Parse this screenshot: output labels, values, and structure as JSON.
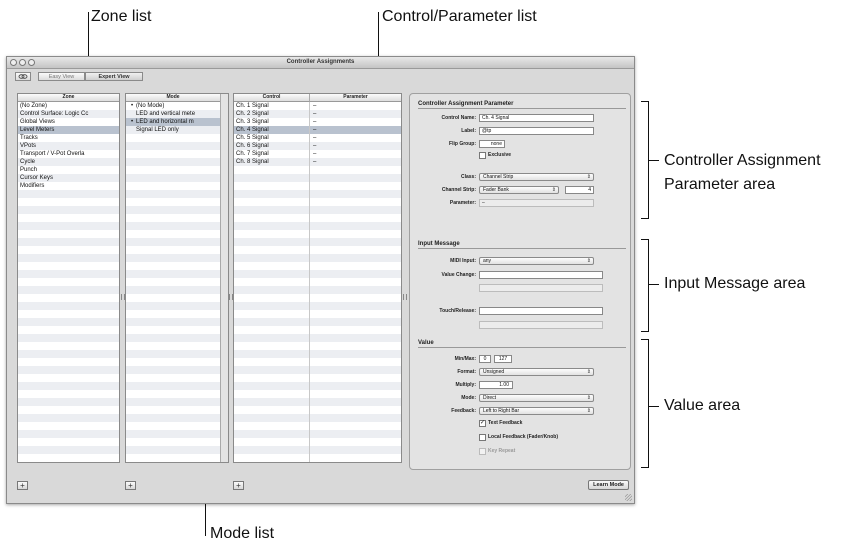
{
  "callouts": {
    "zone_list": "Zone list",
    "control_parameter_list": "Control/Parameter list",
    "ca_param_area_line1": "Controller Assignment",
    "ca_param_area_line2": "Parameter area",
    "input_message_area": "Input Message area",
    "value_area": "Value area",
    "mode_list": "Mode list"
  },
  "window": {
    "title": "Controller Assignments",
    "easy_view": "Easy View",
    "expert_view": "Expert View"
  },
  "zone_list": {
    "header": "Zone",
    "items": [
      "(No Zone)",
      "Control Surface: Logic Cc",
      "Global Views",
      "Level Meters",
      "Tracks",
      "VPots",
      "Transport / V-Pot Overla",
      "Cycle",
      "Punch",
      "Cursor Keys",
      "Modifiers"
    ],
    "selected_index": 3
  },
  "mode_list": {
    "header": "Mode",
    "items": [
      {
        "bullet": "•",
        "label": "(No Mode)"
      },
      {
        "bullet": "",
        "label": "LED and vertical mete"
      },
      {
        "bullet": "•",
        "label": "LED and horizontal m"
      },
      {
        "bullet": "",
        "label": "Signal LED only"
      }
    ],
    "selected_index": 2
  },
  "control_list": {
    "header_control": "Control",
    "header_parameter": "Parameter",
    "rows": [
      {
        "control": "Ch. 1 Signal",
        "parameter": "–"
      },
      {
        "control": "Ch. 2 Signal",
        "parameter": "–"
      },
      {
        "control": "Ch. 3 Signal",
        "parameter": "–"
      },
      {
        "control": "Ch. 4 Signal",
        "parameter": "–"
      },
      {
        "control": "Ch. 5 Signal",
        "parameter": "–"
      },
      {
        "control": "Ch. 6 Signal",
        "parameter": "–"
      },
      {
        "control": "Ch. 7 Signal",
        "parameter": "–"
      },
      {
        "control": "Ch. 8 Signal",
        "parameter": "–"
      }
    ],
    "selected_index": 3
  },
  "params": {
    "section_title": "Controller Assignment Parameter",
    "control_name_label": "Control Name:",
    "control_name_value": "Ch. 4 Signal",
    "label_label": "Label:",
    "label_value": "@tp",
    "flip_group_label": "Flip Group:",
    "flip_group_value": "none",
    "exclusive_label": "Exclusive",
    "class_label": "Class:",
    "class_value": "Channel Strip",
    "channel_strip_label": "Channel Strip:",
    "channel_strip_value": "Fader Bank",
    "channel_strip_number": "4",
    "parameter_label": "Parameter:",
    "parameter_value": "–"
  },
  "input": {
    "section_title": "Input Message",
    "midi_input_label": "MIDI Input:",
    "midi_input_value": "any",
    "value_change_label": "Value Change:",
    "touch_release_label": "Touch/Release:"
  },
  "value": {
    "section_title": "Value",
    "min_max_label": "Min/Max:",
    "min": "0",
    "max": "127",
    "format_label": "Format:",
    "format_value": "Unsigned",
    "multiply_label": "Multiply:",
    "multiply_value": "1.00",
    "mode_label": "Mode:",
    "mode_value": "Direct",
    "feedback_label": "Feedback:",
    "feedback_value": "Left to Right Bar",
    "text_feedback_label": "Text Feedback",
    "text_feedback_checked": "✓",
    "local_feedback_label": "Local Feedback (Fader/Knob)",
    "key_repeat_label": "Key Repeat"
  },
  "footer": {
    "plus": "+",
    "learn_mode": "Learn Mode"
  },
  "icons": {
    "popup_arrows": "⇕"
  }
}
